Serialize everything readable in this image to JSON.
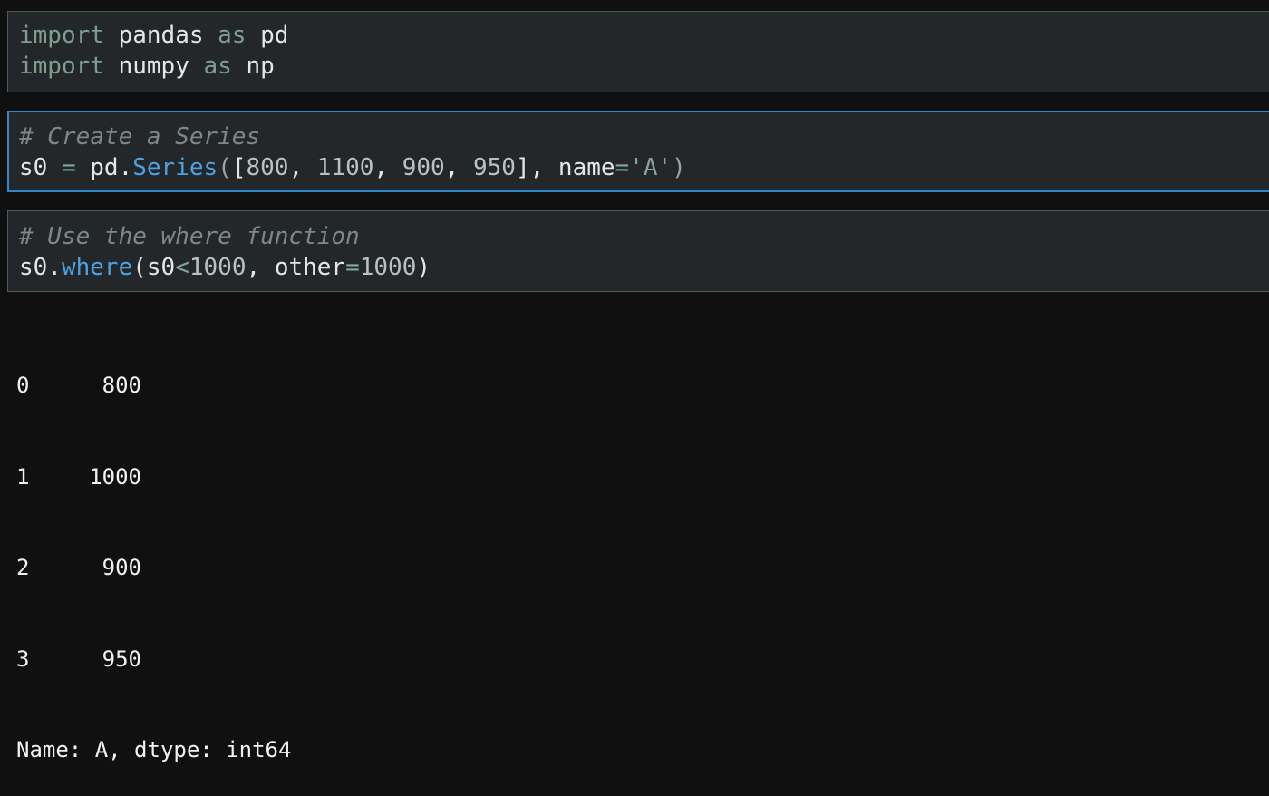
{
  "cells": [
    {
      "lines": [
        {
          "t1": "import",
          "t2": " pandas ",
          "t3": "as",
          "t4": " pd"
        },
        {
          "t1": "import",
          "t2": " numpy ",
          "t3": "as",
          "t4": " np"
        }
      ]
    },
    {
      "comment": "# Create a Series",
      "code": {
        "var": "s0",
        "eq": "=",
        "obj": "pd.",
        "fn": "Series",
        "open": "(",
        "lb": "[",
        "n1": "800",
        "n2": "1100",
        "n3": "900",
        "n4": "950",
        "rb": "]",
        "kwarg": "name",
        "eq2": "=",
        "str": "'A'",
        "close": ")"
      }
    },
    {
      "comment": "# Use the where function",
      "code": {
        "var": "s0.",
        "fn": "where",
        "open": "(",
        "arg1": "s0",
        "lt": "<",
        "n1": "1000",
        "kwarg": "other",
        "eq": "=",
        "n2": "1000",
        "close": ")"
      }
    }
  ],
  "output": {
    "rows": [
      {
        "index": "0",
        "value": "800"
      },
      {
        "index": "1",
        "value": "1000"
      },
      {
        "index": "2",
        "value": "900"
      },
      {
        "index": "3",
        "value": "950"
      }
    ],
    "footer": "Name: A, dtype: int64"
  },
  "colors": {
    "background": "#101010",
    "cell_background": "#23272a",
    "cell_border": "#4d5a58",
    "active_border": "#2f86c8",
    "keyword": "#7f9d8c",
    "function": "#4ea1e0",
    "comment": "#7e8883"
  }
}
